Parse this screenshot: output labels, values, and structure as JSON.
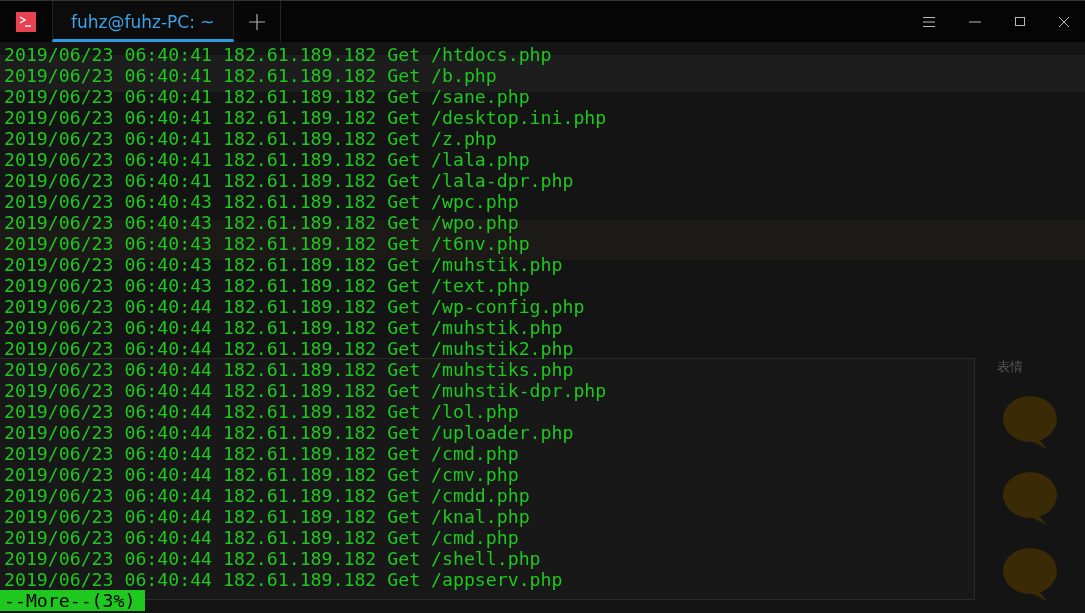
{
  "window": {
    "tabs": [
      {
        "label": "fuhz@fuhz-PC: ~",
        "selected": true
      }
    ]
  },
  "terminal": {
    "lines": [
      "2019/06/23 06:40:41 182.61.189.182 Get /htdocs.php",
      "2019/06/23 06:40:41 182.61.189.182 Get /b.php",
      "2019/06/23 06:40:41 182.61.189.182 Get /sane.php",
      "2019/06/23 06:40:41 182.61.189.182 Get /desktop.ini.php",
      "2019/06/23 06:40:41 182.61.189.182 Get /z.php",
      "2019/06/23 06:40:41 182.61.189.182 Get /lala.php",
      "2019/06/23 06:40:41 182.61.189.182 Get /lala-dpr.php",
      "2019/06/23 06:40:43 182.61.189.182 Get /wpc.php",
      "2019/06/23 06:40:43 182.61.189.182 Get /wpo.php",
      "2019/06/23 06:40:43 182.61.189.182 Get /t6nv.php",
      "2019/06/23 06:40:43 182.61.189.182 Get /muhstik.php",
      "2019/06/23 06:40:43 182.61.189.182 Get /text.php",
      "2019/06/23 06:40:44 182.61.189.182 Get /wp-config.php",
      "2019/06/23 06:40:44 182.61.189.182 Get /muhstik.php",
      "2019/06/23 06:40:44 182.61.189.182 Get /muhstik2.php",
      "2019/06/23 06:40:44 182.61.189.182 Get /muhstiks.php",
      "2019/06/23 06:40:44 182.61.189.182 Get /muhstik-dpr.php",
      "2019/06/23 06:40:44 182.61.189.182 Get /lol.php",
      "2019/06/23 06:40:44 182.61.189.182 Get /uploader.php",
      "2019/06/23 06:40:44 182.61.189.182 Get /cmd.php",
      "2019/06/23 06:40:44 182.61.189.182 Get /cmv.php",
      "2019/06/23 06:40:44 182.61.189.182 Get /cmdd.php",
      "2019/06/23 06:40:44 182.61.189.182 Get /knal.php",
      "2019/06/23 06:40:44 182.61.189.182 Get /cmd.php",
      "2019/06/23 06:40:44 182.61.189.182 Get /shell.php",
      "2019/06/23 06:40:44 182.61.189.182 Get /appserv.php"
    ],
    "pager": "--More--(3%)"
  },
  "background_page": {
    "sidebar_title": "表情"
  }
}
